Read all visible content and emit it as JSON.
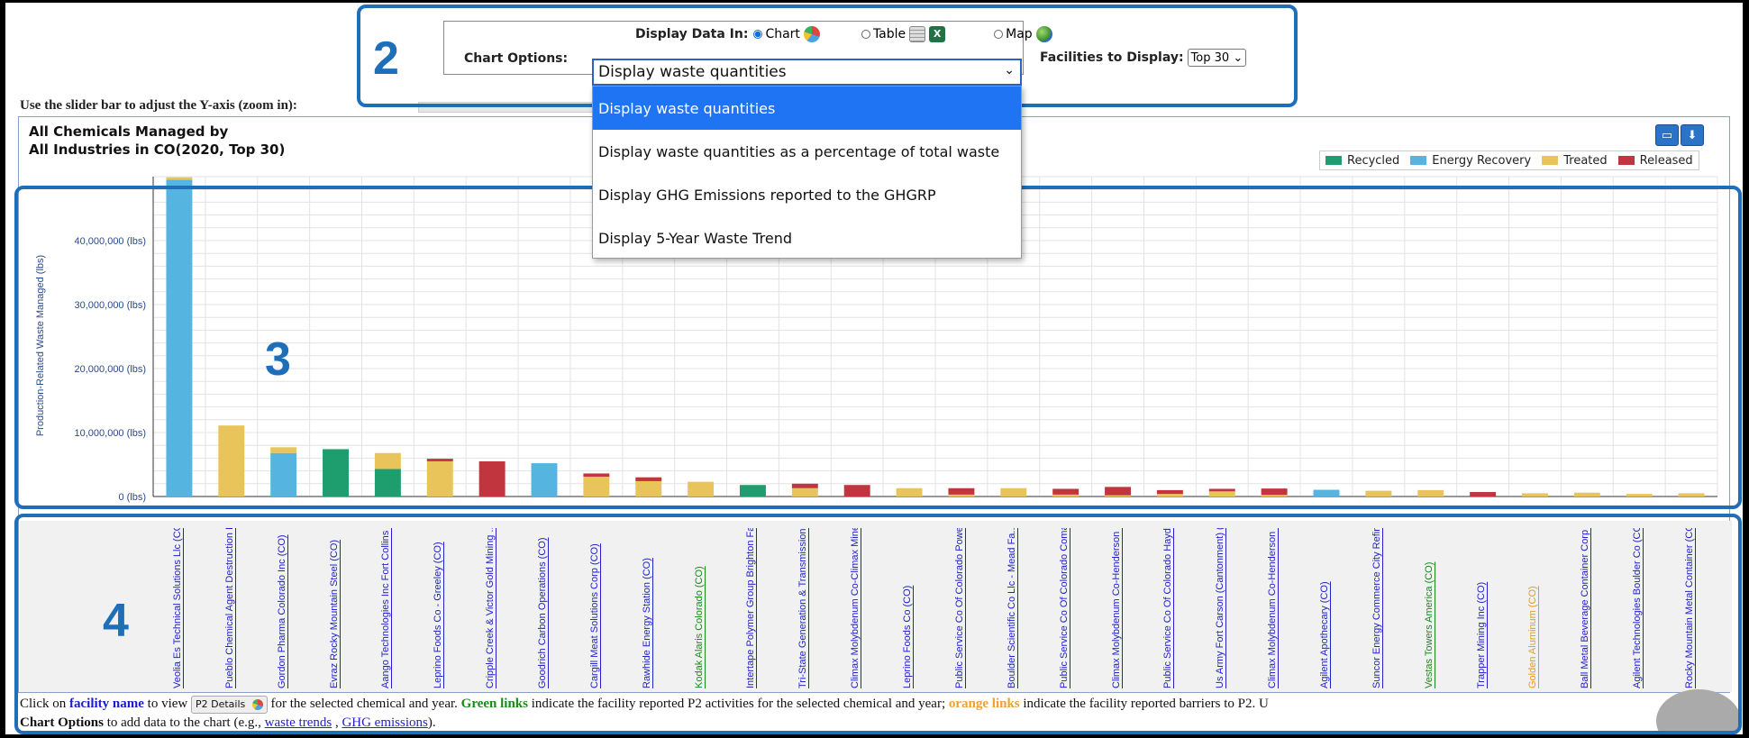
{
  "callouts": {
    "n2": "2",
    "n3": "3",
    "n4": "4"
  },
  "options": {
    "display_label": "Display Data In:",
    "display_chart": "Chart",
    "display_table": "Table",
    "display_map": "Map",
    "chart_options_label": "Chart Options:",
    "chart_options_value": "Display waste quantities",
    "facilities_label": "Facilities to Display:",
    "facilities_value": "Top 30"
  },
  "dropdown": {
    "selected": "Display waste quantities",
    "items": [
      "Display waste quantities",
      "Display waste quantities as a percentage of total waste",
      "Display GHG Emissions reported to the GHGRP",
      "Display 5-Year Waste Trend"
    ]
  },
  "hint": "Use the slider bar to adjust the Y-axis (zoom in):",
  "chart_title_1": "All Chemicals Managed by",
  "chart_title_2": "All Industries in CO(2020, Top 30)",
  "legend": [
    "Recycled",
    "Energy Recovery",
    "Treated",
    "Released"
  ],
  "colors": {
    "Recycled": "#1e9e6e",
    "Energy Recovery": "#55b4e0",
    "Treated": "#e8c45a",
    "Released": "#c0353e"
  },
  "chart_data": {
    "type": "bar",
    "stacked": true,
    "ylabel": "Production-Related Waste Managed (lbs)",
    "ylim": [
      0,
      50000000
    ],
    "yticks": [
      0,
      10000000,
      20000000,
      30000000,
      40000000
    ],
    "ytick_labels": [
      "0 (lbs)",
      "10,000,000 (lbs)",
      "20,000,000 (lbs)",
      "30,000,000 (lbs)",
      "40,000,000 (lbs)"
    ],
    "categories": [
      "Veolia Es Technical Solutions Llc (CO)",
      "Pueblo Chemical Agent Destruction P... (CO)",
      "Gordon Pharma Colorado Inc (CO)",
      "Evraz Rocky Mountain Steel (CO)",
      "Aango Technologies Inc Fort Collins ... (CO)",
      "Leprino Foods Co - Greeley (CO)",
      "Cripple Creek & Victor Gold Mining ... (CO)",
      "Goodrich Carbon Operations (CO)",
      "Cargill Meat Solutions Corp (CO)",
      "Rawhide Energy Station (CO)",
      "Kodak Alaris Colorado (CO)",
      "Intertape Polymer Group Brighton Fa... (CO)",
      "Tri-State Generation & Transmission ... (CO)",
      "Climax Molybdenum Co-Climax Mine (CO)",
      "Leprino Foods Co (CO)",
      "Public Service Co Of Colorado Powe... (CO)",
      "Boulder Scientific Co Llc - Mead Fa... (CO)",
      "Public Service Co Of Colorado Coman... (CO)",
      "Climax Molybdenum Co-Henderson Mine (CO)",
      "Public Service Co Of Colorado Hayde... (CO)",
      "Us Army Fort Carson (Cantonment) (CO)",
      "Climax Molybdenum Co-Henderson Mill (CO)",
      "Agilent Apothecary (CO)",
      "Suncor Energy Commerce City Refiner... (CO)",
      "Vestas Towers America (CO)",
      "Trapper Mining Inc (CO)",
      "Golden Aluminum (CO)",
      "Ball Metal Beverage Container Corp (CO)",
      "Agilent Technologies Boulder Co (CO)",
      "Rocky Mountain Metal Container (CO)"
    ],
    "link_colors": [
      "blue",
      "blue",
      "blue",
      "blue",
      "blue",
      "blue",
      "blue",
      "blue",
      "blue",
      "blue",
      "green",
      "blue",
      "blue",
      "blue",
      "blue",
      "blue",
      "blue",
      "blue",
      "blue",
      "blue",
      "blue",
      "blue",
      "blue",
      "blue",
      "green",
      "blue",
      "orange",
      "blue",
      "blue",
      "blue"
    ],
    "series": [
      {
        "name": "Recycled",
        "values": [
          0,
          0,
          0,
          7400000,
          4300000,
          0,
          0,
          0,
          0,
          0,
          0,
          1800000,
          0,
          0,
          0,
          0,
          0,
          0,
          0,
          0,
          0,
          0,
          0,
          0,
          0,
          0,
          0,
          0,
          0,
          0
        ]
      },
      {
        "name": "Energy Recovery",
        "values": [
          49500000,
          0,
          6800000,
          0,
          0,
          0,
          0,
          5200000,
          0,
          0,
          0,
          0,
          0,
          0,
          0,
          0,
          0,
          0,
          0,
          0,
          0,
          0,
          1050000,
          0,
          0,
          0,
          0,
          0,
          0,
          0
        ]
      },
      {
        "name": "Treated",
        "values": [
          400000,
          11100000,
          900000,
          0,
          2500000,
          5500000,
          0,
          0,
          3100000,
          2400000,
          2300000,
          0,
          1300000,
          0,
          1300000,
          300000,
          1300000,
          300000,
          200000,
          400000,
          800000,
          250000,
          0,
          900000,
          1000000,
          0,
          500000,
          600000,
          400000,
          500000
        ]
      },
      {
        "name": "Released",
        "values": [
          0,
          0,
          0,
          0,
          0,
          400000,
          5500000,
          0,
          500000,
          600000,
          0,
          0,
          700000,
          1800000,
          0,
          1000000,
          0,
          900000,
          1300000,
          600000,
          400000,
          1000000,
          0,
          0,
          0,
          700000,
          0,
          0,
          0,
          0
        ]
      }
    ]
  },
  "footer": {
    "t1": "Click on ",
    "facility_name": "facility name",
    "t2": " to view ",
    "p2_btn": "P2 Details",
    "t3": " for the selected chemical and year. ",
    "green_links": "Green links",
    "t4": " indicate the facility reported P2 activities for the selected chemical and year; ",
    "orange_links": "orange links",
    "t5": " indicate the facility reported barriers to P2. U",
    "chart_options": "Chart Options",
    "t6": " to add data to the chart (e.g., ",
    "waste_trends": "waste trends",
    "t7": " , ",
    "ghg": "GHG emissions",
    "t8": ")."
  }
}
